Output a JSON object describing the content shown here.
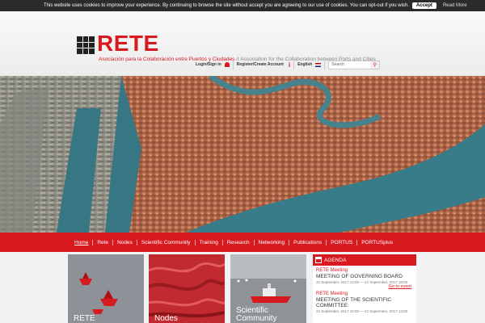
{
  "cookie": {
    "message": "This website uses cookies to improve your experience. By continuing to browse the site without accept you are agreeing to our use of cookies. You can opt-out if you wish.",
    "accept_label": "Accept",
    "read_more_label": "Read More"
  },
  "header": {
    "logo_text": "RETE",
    "tagline_es": "Asociación para la Colaboración entre Puertos y Ciudades",
    "tagline_sep": " // ",
    "tagline_en": "Association for the Collaboration between Ports and Cities"
  },
  "toolbar": {
    "login_label": "Login/Sign in",
    "register_label": "Register/Create Account",
    "language_label": "English",
    "search_placeholder": "Search"
  },
  "nav": {
    "items": [
      {
        "label": "Home"
      },
      {
        "label": "Rete"
      },
      {
        "label": "Nodes"
      },
      {
        "label": "Scientific Community"
      },
      {
        "label": "Training"
      },
      {
        "label": "Research"
      },
      {
        "label": "Networking"
      },
      {
        "label": "Publications"
      },
      {
        "label": "PORTUS"
      },
      {
        "label": "PORTUSplus"
      }
    ]
  },
  "tiles": {
    "rete": "RETE",
    "nodes": "Nodes",
    "scientific_line1": "Scientific",
    "scientific_line2": "Community"
  },
  "agenda": {
    "title": "AGENDA",
    "events": [
      {
        "type": "RETE Meeting",
        "name": "MEETING OF GOVERNING BOARD",
        "date": "22 September, 2017 14:00 — 22 September, 2017 18:00"
      },
      {
        "type": "RETE Meeting",
        "name": "MEETING OF THE SCIENTIFIC COMMITTEE",
        "date": "22 September, 2017 10:00 — 22 September, 2017 13:00"
      }
    ],
    "go_to_event": "Go to event"
  },
  "colors": {
    "brand_red": "#d71920",
    "cookie_bar": "#2b2b2b",
    "sea": "#2b6b7c"
  }
}
